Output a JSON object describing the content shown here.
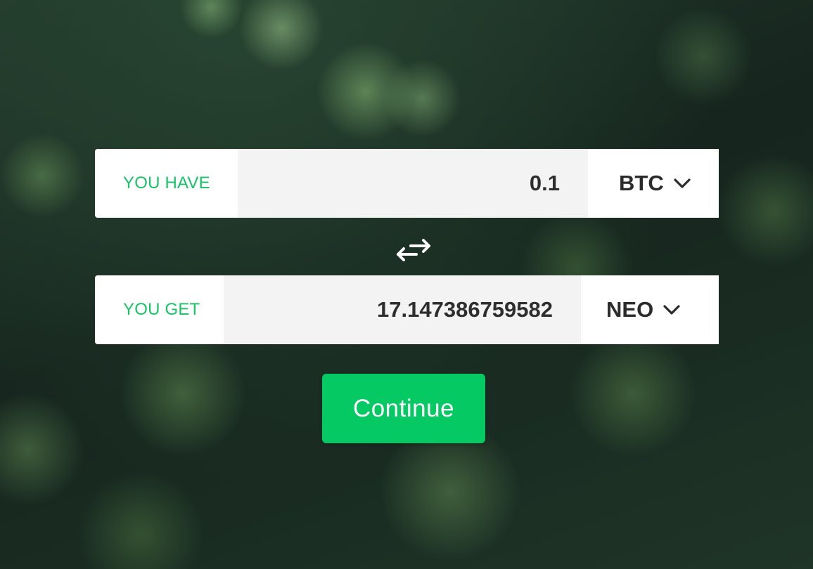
{
  "exchange": {
    "have": {
      "label": "YOU HAVE",
      "amount": "0.1",
      "currency": "BTC"
    },
    "get": {
      "label": "YOU GET",
      "amount": "17.147386759582",
      "currency": "NEO"
    },
    "swap_icon": "swap-arrows-icon",
    "continue_label": "Continue"
  },
  "colors": {
    "accent_green": "#05c963",
    "label_green": "#17c466",
    "field_bg": "#f3f3f3",
    "text_dark": "#2e2e2e"
  }
}
